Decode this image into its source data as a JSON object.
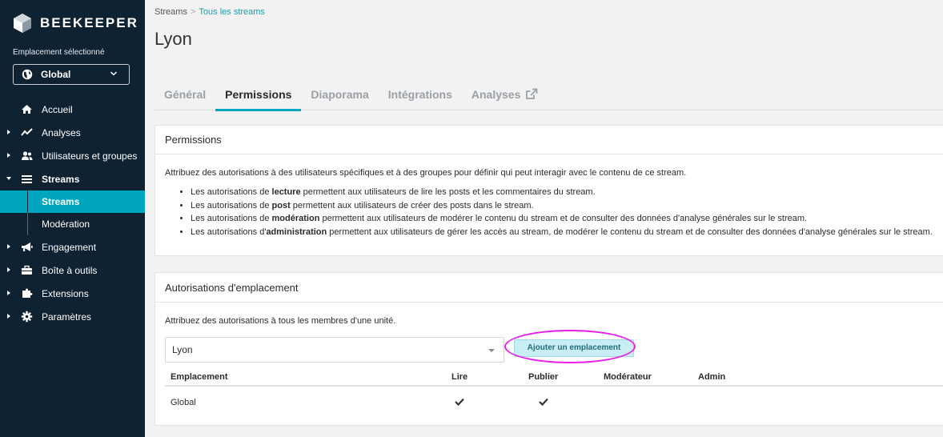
{
  "brand": {
    "name": "BEEKEEPER",
    "accent": "#00a5c0",
    "sidebar_bg": "#0e2232"
  },
  "location": {
    "label": "Emplacement sélectionné",
    "value": "Global",
    "icon": "globe-icon"
  },
  "nav": [
    {
      "label": "Accueil",
      "icon": "home-icon",
      "caret": false
    },
    {
      "label": "Analyses",
      "icon": "chart-icon",
      "caret": true
    },
    {
      "label": "Utilisateurs et groupes",
      "icon": "users-icon",
      "caret": true
    },
    {
      "label": "Streams",
      "icon": "list-icon",
      "caret": true,
      "expanded": true
    },
    {
      "label": "Streams",
      "sub": true,
      "active": true
    },
    {
      "label": "Modération",
      "sub": true
    },
    {
      "label": "Engagement",
      "icon": "megaphone-icon",
      "caret": true
    },
    {
      "label": "Boîte à outils",
      "icon": "toolbox-icon",
      "caret": true
    },
    {
      "label": "Extensions",
      "icon": "puzzle-icon",
      "caret": true
    },
    {
      "label": "Paramètres",
      "icon": "gear-icon",
      "caret": true
    }
  ],
  "breadcrumb": {
    "root": "Streams",
    "separator": ">",
    "current": "Tous les streams"
  },
  "page_title": "Lyon",
  "tabs": [
    {
      "label": "Général",
      "active": false
    },
    {
      "label": "Permissions",
      "active": true
    },
    {
      "label": "Diaporama",
      "active": false
    },
    {
      "label": "Intégrations",
      "active": false
    },
    {
      "label": "Analyses",
      "active": false,
      "external": true
    }
  ],
  "permissions_card": {
    "title": "Permissions",
    "intro": "Attribuez des autorisations à des utilisateurs spécifiques et à des groupes pour définir qui peut interagir avec le contenu de ce stream.",
    "bullets": [
      {
        "pre": "Les autorisations de ",
        "bold": "lecture",
        "post": " permettent aux utilisateurs de lire les posts et les commentaires du stream."
      },
      {
        "pre": "Les autorisations de ",
        "bold": "post",
        "post": " permettent aux utilisateurs de créer des posts dans le stream."
      },
      {
        "pre": "Les autorisations de ",
        "bold": "modération",
        "post": " permettent aux utilisateurs de modérer le contenu du stream et de consulter des données d'analyse générales sur le stream."
      },
      {
        "pre": "Les autorisations d'",
        "bold": "administration",
        "post": " permettent aux utilisateurs de gérer les accès au stream, de modérer le contenu du stream et de consulter des données d'analyse générales sur le stream."
      }
    ]
  },
  "location_card": {
    "title": "Autorisations d'emplacement",
    "intro": "Attribuez des autorisations à tous les membres d'une unité.",
    "dropdown_value": "Lyon",
    "add_button": "Ajouter un emplacement",
    "columns": [
      "Emplacement",
      "Lire",
      "Publier",
      "Modérateur",
      "Admin"
    ],
    "rows": [
      {
        "location": "Global",
        "read": true,
        "publish": true,
        "moderator": false,
        "admin": false
      }
    ]
  }
}
